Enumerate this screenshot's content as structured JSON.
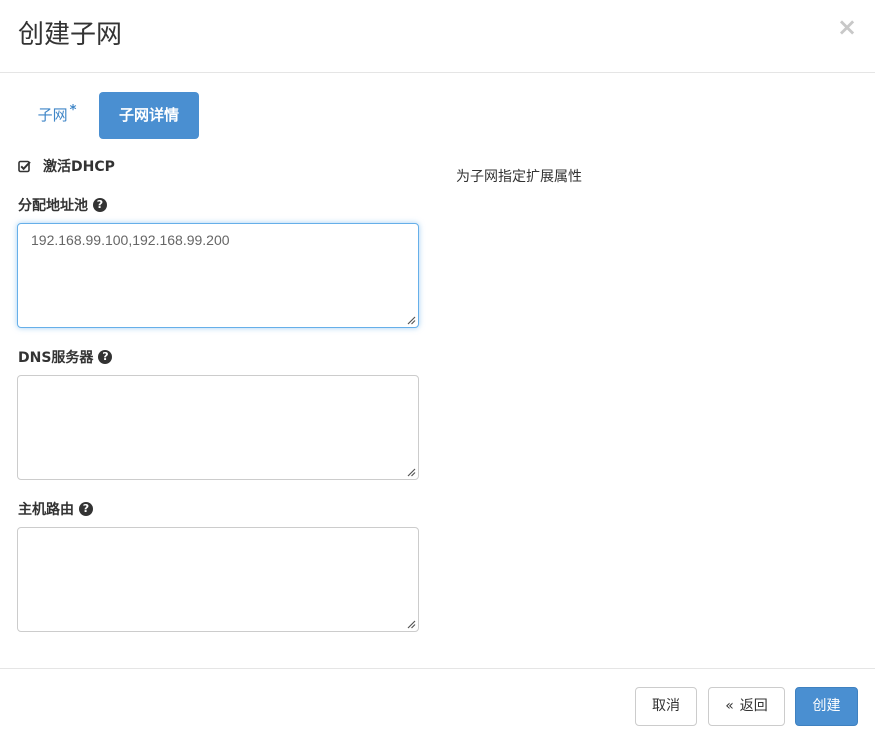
{
  "modal": {
    "title": "创建子网",
    "close_icon": "×"
  },
  "tabs": [
    {
      "label": "子网",
      "required_marker": "*",
      "active": false
    },
    {
      "label": "子网详情",
      "active": true
    }
  ],
  "form": {
    "enable_dhcp": {
      "label": "激活DHCP",
      "checked": true
    },
    "allocation_pools": {
      "label": "分配地址池",
      "value": "192.168.99.100,192.168.99.200"
    },
    "dns_servers": {
      "label": "DNS服务器",
      "value": ""
    },
    "host_routes": {
      "label": "主机路由",
      "value": ""
    }
  },
  "help_text": "为子网指定扩展属性",
  "footer": {
    "cancel_label": "取消",
    "back_label": "返回",
    "back_icon": "«",
    "create_label": "创建"
  },
  "colors": {
    "accent": "#4a8fd1",
    "tab_link": "#3f86c7",
    "focus_border": "#66afe9"
  },
  "icons": {
    "help": "question-circle-icon",
    "checkbox": "checkbox-checked-icon",
    "close": "close-icon"
  }
}
